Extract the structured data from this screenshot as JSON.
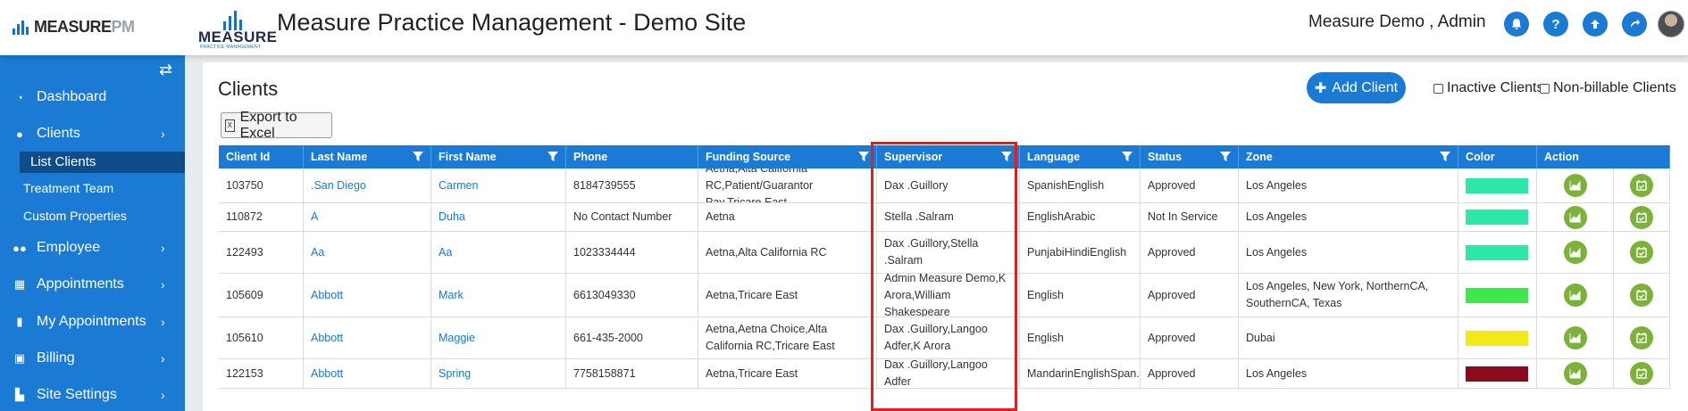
{
  "header": {
    "brand_main": "MEASURE",
    "brand_accent": "PM",
    "logo_word": "MEASURE",
    "logo_sub": "PRACTICE MANAGEMENT",
    "title": "Measure Practice Management - Demo Site",
    "user": "Measure Demo , Admin",
    "icons": [
      "bell-icon",
      "help-icon",
      "upload-icon",
      "redo-icon"
    ]
  },
  "sidebar": {
    "items": [
      {
        "label": "Dashboard",
        "icon": "dashboard-icon"
      },
      {
        "label": "Clients",
        "icon": "user-icon"
      },
      {
        "label": "Employee",
        "icon": "users-icon"
      },
      {
        "label": "Appointments",
        "icon": "calendar-icon"
      },
      {
        "label": "My Appointments",
        "icon": "book-icon"
      },
      {
        "label": "Billing",
        "icon": "money-icon"
      },
      {
        "label": "Site Settings",
        "icon": "settings-icon"
      }
    ],
    "sub_items": [
      "List Clients",
      "Treatment Team",
      "Custom Properties"
    ]
  },
  "page": {
    "title": "Clients",
    "add_label": "Add Client",
    "inactive_label": "Inactive Clients",
    "nonbillable_label": "Non-billable Clients",
    "export_label": "Export to Excel"
  },
  "table": {
    "columns": [
      "Client Id",
      "Last Name",
      "First Name",
      "Phone",
      "Funding Source",
      "Supervisor",
      "Language",
      "Status",
      "Zone",
      "Color",
      "Action"
    ],
    "rows": [
      {
        "id": "103750",
        "last": ".San Diego",
        "first": "Carmen",
        "phone": "8184739555",
        "funding": "Aetna,Alta California RC,Patient/Guarantor Pay,Tricare East",
        "supervisor": "Dax .Guillory",
        "language": "SpanishEnglish",
        "status": "Approved",
        "zone": "Los Angeles",
        "color": "#2de8a8"
      },
      {
        "id": "110872",
        "last": "A",
        "first": "Duha",
        "phone": "No Contact Number",
        "funding": "Aetna",
        "supervisor": "Stella .Salram",
        "language": "EnglishArabic",
        "status": "Not In Service",
        "zone": "Los Angeles",
        "color": "#2de8a8"
      },
      {
        "id": "122493",
        "last": "Aa",
        "first": "Aa",
        "phone": "1023334444",
        "funding": "Aetna,Alta California RC",
        "supervisor": "Dax .Guillory,Stella .Salram",
        "language": "PunjabiHindiEnglish",
        "status": "Approved",
        "zone": "Los Angeles",
        "color": "#2de8a8"
      },
      {
        "id": "105609",
        "last": "Abbott",
        "first": "Mark",
        "phone": "6613049330",
        "funding": "Aetna,Tricare East",
        "supervisor": "Admin Measure Demo,K Arora,William Shakespeare",
        "language": "English",
        "status": "Approved",
        "zone": "Los Angeles, New York, NorthernCA, SouthernCA, Texas",
        "color": "#3ee84a"
      },
      {
        "id": "105610",
        "last": "Abbott",
        "first": "Maggie",
        "phone": "661-435-2000",
        "funding": "Aetna,Aetna Choice,Alta California RC,Tricare East",
        "supervisor": "Dax .Guillory,Langoo Adfer,K Arora",
        "language": "English",
        "status": "Approved",
        "zone": "Dubai",
        "color": "#f2ea16"
      },
      {
        "id": "122153",
        "last": "Abbott",
        "first": "Spring",
        "phone": "7758158871",
        "funding": "Aetna,Tricare East",
        "supervisor": "Dax .Guillory,Langoo Adfer",
        "language": "MandarinEnglishSpan...",
        "status": "Approved",
        "zone": "Los Angeles",
        "color": "#8a0a1e"
      }
    ]
  }
}
